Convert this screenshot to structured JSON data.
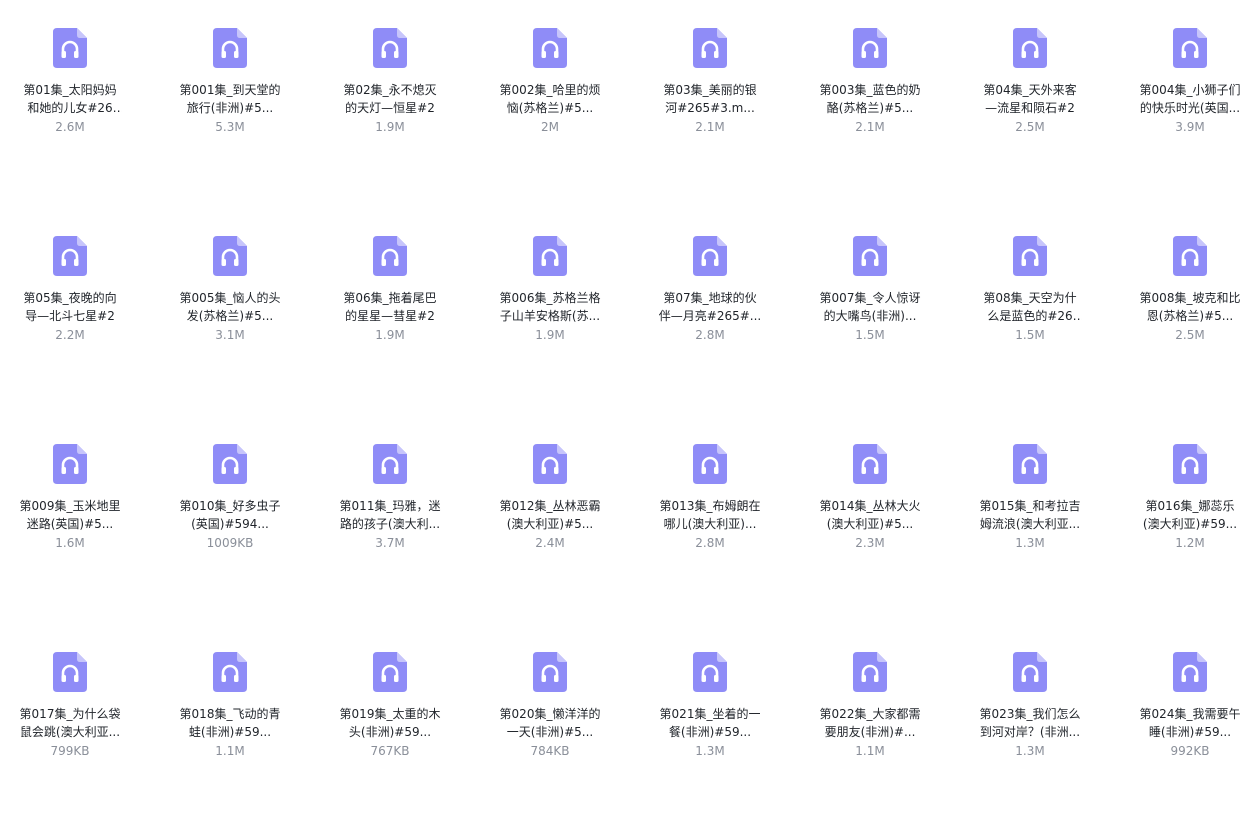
{
  "colors": {
    "icon_fill": "#8f8cf7",
    "icon_fold": "#c7c5fb",
    "name_text": "#1f2329",
    "size_text": "#8a8f99"
  },
  "files": [
    {
      "name": "第01集_太阳妈妈和她的儿女#265...",
      "size": "2.6M",
      "icon": "audio-file-icon"
    },
    {
      "name": "第001集_到天堂的旅行(非洲)#5...",
      "size": "5.3M",
      "icon": "audio-file-icon"
    },
    {
      "name": "第02集_永不熄灭的天灯—恒星#2",
      "size": "1.9M",
      "icon": "audio-file-icon"
    },
    {
      "name": "第002集_哈里的烦恼(苏格兰)#5...",
      "size": "2M",
      "icon": "audio-file-icon"
    },
    {
      "name": "第03集_美丽的银河#265#3.m...",
      "size": "2.1M",
      "icon": "audio-file-icon"
    },
    {
      "name": "第003集_蓝色的奶酪(苏格兰)#5...",
      "size": "2.1M",
      "icon": "audio-file-icon"
    },
    {
      "name": "第04集_天外来客—流星和陨石#2",
      "size": "2.5M",
      "icon": "audio-file-icon"
    },
    {
      "name": "第004集_小狮子们的快乐时光(英国...",
      "size": "3.9M",
      "icon": "audio-file-icon"
    },
    {
      "name": "第05集_夜晚的向导—北斗七星#2",
      "size": "2.2M",
      "icon": "audio-file-icon"
    },
    {
      "name": "第005集_恼人的头发(苏格兰)#5...",
      "size": "3.1M",
      "icon": "audio-file-icon"
    },
    {
      "name": "第06集_拖着尾巴的星星—彗星#2",
      "size": "1.9M",
      "icon": "audio-file-icon"
    },
    {
      "name": "第006集_苏格兰格子山羊安格斯(苏...",
      "size": "1.9M",
      "icon": "audio-file-icon"
    },
    {
      "name": "第07集_地球的伙伴—月亮#265#...",
      "size": "2.8M",
      "icon": "audio-file-icon"
    },
    {
      "name": "第007集_令人惊讶的大嘴鸟(非洲)...",
      "size": "1.5M",
      "icon": "audio-file-icon"
    },
    {
      "name": "第08集_天空为什么是蓝色的#265...",
      "size": "1.5M",
      "icon": "audio-file-icon"
    },
    {
      "name": "第008集_坡克和比恩(苏格兰)#5...",
      "size": "2.5M",
      "icon": "audio-file-icon"
    },
    {
      "name": "第009集_玉米地里迷路(英国)#5...",
      "size": "1.6M",
      "icon": "audio-file-icon"
    },
    {
      "name": "第010集_好多虫子(英国)#594...",
      "size": "1009KB",
      "icon": "audio-file-icon"
    },
    {
      "name": "第011集_玛雅，迷路的孩子(澳大利...",
      "size": "3.7M",
      "icon": "audio-file-icon"
    },
    {
      "name": "第012集_丛林恶霸(澳大利亚)#5...",
      "size": "2.4M",
      "icon": "audio-file-icon"
    },
    {
      "name": "第013集_布姆朗在哪儿(澳大利亚)...",
      "size": "2.8M",
      "icon": "audio-file-icon"
    },
    {
      "name": "第014集_丛林大火(澳大利亚)#5...",
      "size": "2.3M",
      "icon": "audio-file-icon"
    },
    {
      "name": "第015集_和考拉吉姆流浪(澳大利亚...",
      "size": "1.3M",
      "icon": "audio-file-icon"
    },
    {
      "name": "第016集_娜蕊乐(澳大利亚)#59...",
      "size": "1.2M",
      "icon": "audio-file-icon"
    },
    {
      "name": "第017集_为什么袋鼠会跳(澳大利亚...",
      "size": "799KB",
      "icon": "audio-file-icon"
    },
    {
      "name": "第018集_飞动的青蛙(非洲)#59...",
      "size": "1.1M",
      "icon": "audio-file-icon"
    },
    {
      "name": "第019集_太重的木头(非洲)#59...",
      "size": "767KB",
      "icon": "audio-file-icon"
    },
    {
      "name": "第020集_懒洋洋的一天(非洲)#5...",
      "size": "784KB",
      "icon": "audio-file-icon"
    },
    {
      "name": "第021集_坐着的一餐(非洲)#59...",
      "size": "1.3M",
      "icon": "audio-file-icon"
    },
    {
      "name": "第022集_大家都需要朋友(非洲)#...",
      "size": "1.1M",
      "icon": "audio-file-icon"
    },
    {
      "name": "第023集_我们怎么到河对岸？(非洲...",
      "size": "1.3M",
      "icon": "audio-file-icon"
    },
    {
      "name": "第024集_我需要午睡(非洲)#59...",
      "size": "992KB",
      "icon": "audio-file-icon"
    }
  ]
}
